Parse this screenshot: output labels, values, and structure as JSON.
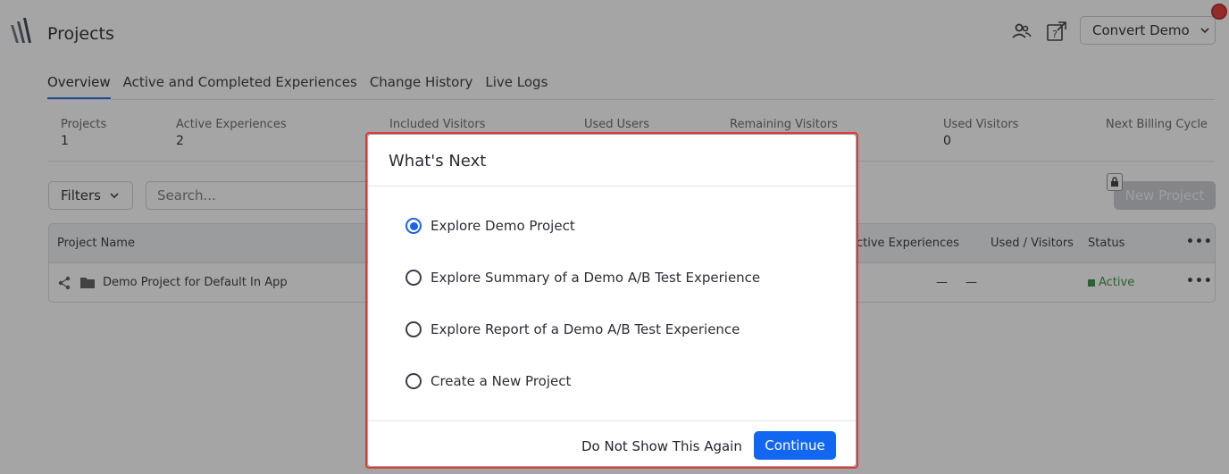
{
  "header": {
    "page_title": "Projects",
    "account_label": "Convert Demo"
  },
  "tabs": [
    {
      "label": "Overview",
      "active": true
    },
    {
      "label": "Active and Completed Experiences"
    },
    {
      "label": "Change History"
    },
    {
      "label": "Live Logs"
    }
  ],
  "stats": [
    {
      "label": "Projects",
      "value": "1"
    },
    {
      "label": "Active Experiences",
      "value": "2"
    },
    {
      "label": "Included Visitors",
      "value": ""
    },
    {
      "label": "Used Users",
      "value": ""
    },
    {
      "label": "Remaining Visitors",
      "value": ""
    },
    {
      "label": "Used Visitors",
      "value": "0"
    },
    {
      "label": "Next Billing Cycle",
      "value": ""
    }
  ],
  "toolbar": {
    "filters_label": "Filters",
    "search_placeholder": "Search...",
    "new_project_label": "New Project"
  },
  "table": {
    "columns": [
      "Project Name",
      "ctive Experiences",
      "Used / Visitors",
      "Status",
      "•••"
    ],
    "rows": [
      {
        "name": "Demo Project for Default In App",
        "experiences": "—",
        "visitors": "—",
        "status": "Active",
        "menu": "•••"
      }
    ]
  },
  "modal": {
    "title": "What's Next",
    "options": [
      {
        "label": "Explore Demo Project",
        "selected": true
      },
      {
        "label": "Explore Summary of a Demo A/B Test Experience",
        "selected": false
      },
      {
        "label": "Explore Report of a Demo A/B Test Experience",
        "selected": false
      },
      {
        "label": "Create a New Project",
        "selected": false
      }
    ],
    "dont_show_label": "Do Not Show This Again",
    "continue_label": "Continue"
  },
  "colors": {
    "accent": "#1167f2",
    "active_status": "#2e8b3a",
    "highlight_outline": "#e03a3a"
  }
}
